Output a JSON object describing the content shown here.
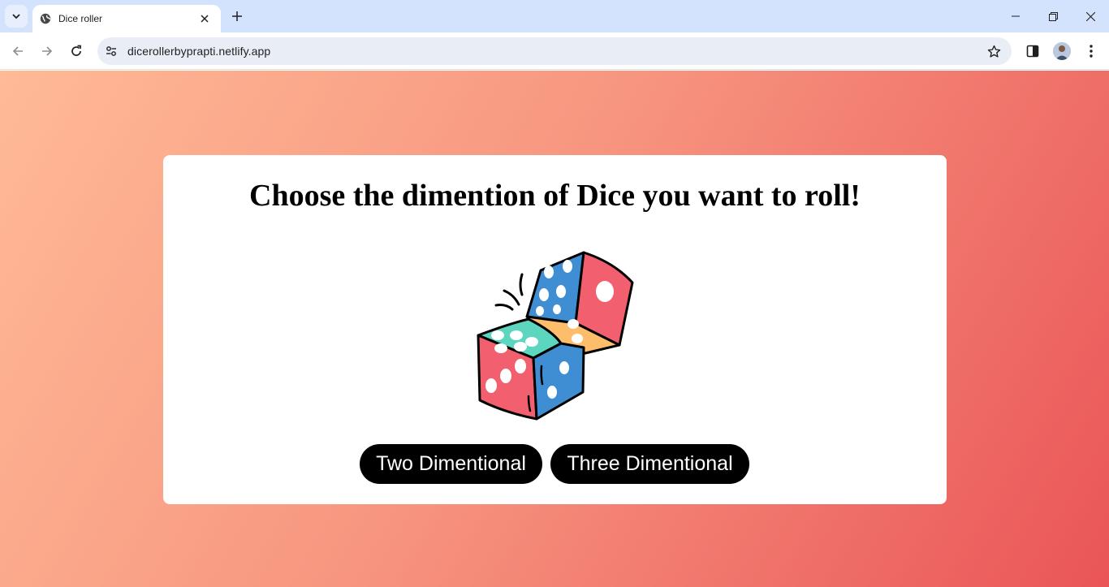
{
  "browser": {
    "tab_title": "Dice roller",
    "url": "dicerollerbyprapti.netlify.app"
  },
  "page": {
    "heading": "Choose the dimention of Dice you want to roll!",
    "buttons": {
      "two_d": "Two Dimentional",
      "three_d": "Three Dimentional"
    },
    "icons": [
      "dice-illustration"
    ]
  },
  "colors": {
    "gradient_start": "#ffba96",
    "gradient_end": "#ea5558",
    "button_bg": "#000000",
    "tab_strip": "#d3e3fd"
  }
}
